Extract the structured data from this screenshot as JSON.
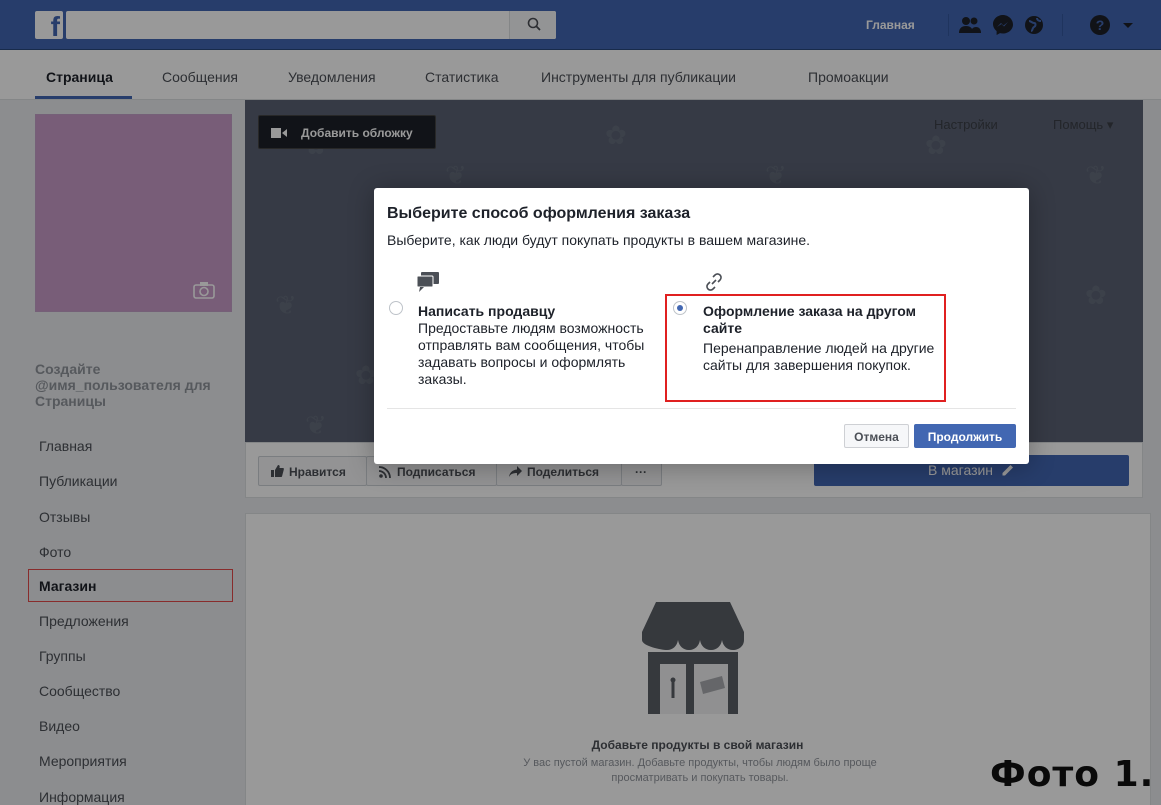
{
  "topbar": {
    "logo": "f",
    "search_placeholder": "",
    "home_label": "Главная"
  },
  "tabs": [
    {
      "label": "Страница"
    },
    {
      "label": "Сообщения"
    },
    {
      "label": "Уведомления"
    },
    {
      "label": "Статистика"
    },
    {
      "label": "Инструменты для публикации"
    },
    {
      "label": "Промоакции"
    }
  ],
  "sidebar": {
    "create_username": "Создайте @имя_пользователя для Страницы",
    "items": [
      {
        "label": "Главная"
      },
      {
        "label": "Публикации"
      },
      {
        "label": "Отзывы"
      },
      {
        "label": "Фото"
      },
      {
        "label": "Магазин"
      },
      {
        "label": "Предложения"
      },
      {
        "label": "Группы"
      },
      {
        "label": "Сообщество"
      },
      {
        "label": "Видео"
      },
      {
        "label": "Мероприятия"
      },
      {
        "label": "Информация"
      }
    ]
  },
  "cover": {
    "add_cover_label": "Добавить обложку",
    "settings_label": "Настройки",
    "help_label": "Помощь ▾"
  },
  "actions": {
    "like_label": "Нравится",
    "subscribe_label": "Подписаться",
    "share_label": "Поделиться",
    "more_label": "···",
    "shop_label": "В магазин"
  },
  "content": {
    "empty_title": "Добавьте продукты в свой магазин",
    "empty_desc": "У вас пустой магазин. Добавьте продукты, чтобы людям было проще просматривать и покупать товары.",
    "photo_label": "Фото 1."
  },
  "modal": {
    "title": "Выберите способ оформления заказа",
    "subtitle": "Выберите, как люди будут покупать продукты в вашем магазине.",
    "option1": {
      "title": "Написать продавцу",
      "desc": "Предоставьте людям возможность отправлять вам сообщения, чтобы задавать вопросы и оформлять заказы."
    },
    "option2": {
      "title": "Оформление заказа на другом сайте",
      "desc": "Перенаправление людей на другие сайты для завершения покупок."
    },
    "cancel_label": "Отмена",
    "continue_label": "Продолжить"
  },
  "colors": {
    "brand": "#4267b2",
    "highlight": "#e02020"
  }
}
